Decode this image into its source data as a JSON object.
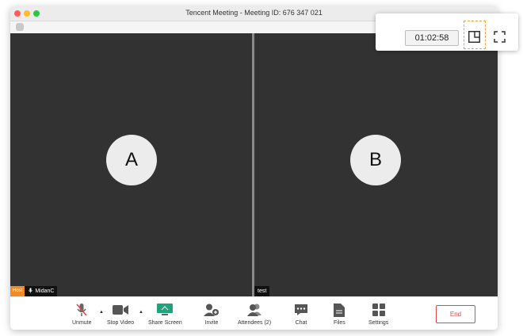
{
  "window": {
    "title": "Tencent Meeting - Meeting ID: 676 347 021"
  },
  "participants": [
    {
      "avatar_letter": "A",
      "host_badge": "Host",
      "name": "MidanC"
    },
    {
      "avatar_letter": "B",
      "name": "test"
    }
  ],
  "toolbar": {
    "unmute_label": "Unmute",
    "stop_video_label": "Stop Video",
    "share_screen_label": "Share Screen",
    "invite_label": "Invite",
    "attendees_label": "Attendees (2)",
    "chat_label": "Chat",
    "files_label": "Files",
    "settings_label": "Settings",
    "end_label": "End",
    "caret_glyph": "▲"
  },
  "float_panel": {
    "timer": "01:02:58"
  },
  "colors": {
    "accent_share": "#1fa37a",
    "end_red": "#e04747",
    "host_orange": "#f08a24",
    "highlight_dashed": "#f0a43a"
  },
  "icons": {
    "mic": "mic-muted-icon",
    "video": "video-camera-icon",
    "share": "share-screen-icon",
    "invite": "add-person-icon",
    "attendees": "people-icon",
    "chat": "chat-bubble-icon",
    "files": "file-icon",
    "settings": "settings-grid-icon",
    "pip": "picture-in-picture-icon",
    "fullscreen": "fullscreen-icon"
  }
}
